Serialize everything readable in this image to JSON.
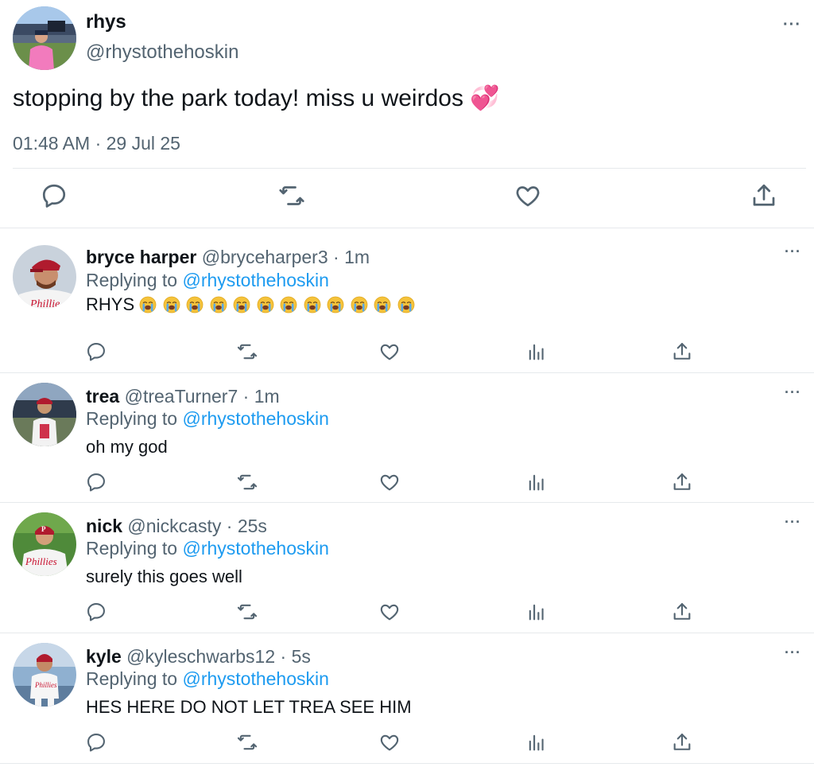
{
  "main_tweet": {
    "name": "rhys",
    "handle": "@rhystothehoskin",
    "text": "stopping by the park today! miss u weirdos",
    "text_emoji": "💞",
    "timestamp": "01:48 AM · 29 Jul 25",
    "more": "···",
    "avatar": "avatar-rhys",
    "actions": [
      "reply-icon",
      "retweet-icon",
      "like-icon",
      "share-icon"
    ]
  },
  "replies": [
    {
      "name": "bryce harper",
      "handle": "@bryceharper3",
      "dot": "·",
      "time": "1m",
      "replying_prefix": "Replying to",
      "replying_handle": "@rhystothehoskin",
      "text": "RHYS",
      "emoji_count": 12,
      "emoji_name": "loudly-crying-face",
      "more": "···",
      "avatar": "avatar-bryce"
    },
    {
      "name": "trea",
      "handle": "@treaTurner7",
      "dot": "·",
      "time": "1m",
      "replying_prefix": "Replying to",
      "replying_handle": "@rhystothehoskin",
      "text": "oh my god",
      "more": "···",
      "avatar": "avatar-trea"
    },
    {
      "name": "nick",
      "handle": "@nickcasty",
      "dot": "·",
      "time": "25s",
      "replying_prefix": "Replying to",
      "replying_handle": "@rhystothehoskin",
      "text": "surely this goes well",
      "more": "···",
      "avatar": "avatar-nick"
    },
    {
      "name": "kyle",
      "handle": "@kyleschwarbs12",
      "dot": "·",
      "time": "5s",
      "replying_prefix": "Replying to",
      "replying_handle": "@rhystothehoskin",
      "text": "HES HERE DO NOT LET TREA SEE HIM",
      "more": "···",
      "avatar": "avatar-kyle"
    }
  ],
  "reply_actions": [
    "reply-icon",
    "retweet-icon",
    "like-icon",
    "views-icon",
    "share-icon"
  ],
  "colors": {
    "text": "#0f1419",
    "secondary": "#536471",
    "link": "#1d9bf0",
    "divider": "#e6e9ec",
    "phillies_red": "#c8102e"
  }
}
